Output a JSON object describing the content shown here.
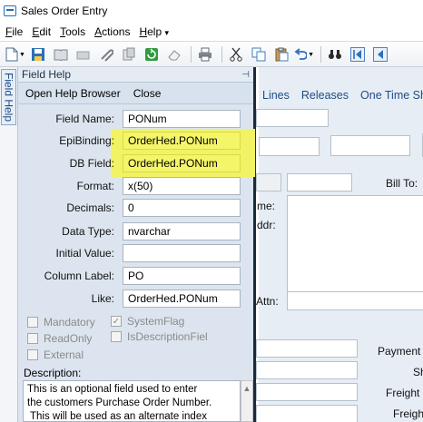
{
  "window": {
    "title": "Sales Order Entry"
  },
  "menubar": [
    {
      "hotkey": "F",
      "rest": "ile"
    },
    {
      "hotkey": "E",
      "rest": "dit"
    },
    {
      "hotkey": "T",
      "rest": "ools"
    },
    {
      "hotkey": "A",
      "rest": "ctions"
    },
    {
      "hotkey": "H",
      "rest": "elp"
    }
  ],
  "menu_overflow": "▾",
  "toolbar": {
    "icons": [
      "new-icon",
      "save-icon",
      "book-icon",
      "erase-icon",
      "attach-icon",
      "copy-doc-icon",
      "refresh-icon",
      "eraser-icon",
      "print-icon",
      "cut-icon",
      "copy-icon",
      "paste-icon",
      "undo-icon",
      "find-icon",
      "first-record-icon",
      "prev-record-icon"
    ]
  },
  "sidetab": {
    "label": "Field Help"
  },
  "help_panel": {
    "title": "Field Help",
    "pin": "⊣",
    "actions": {
      "open": "Open Help Browser",
      "close": "Close"
    },
    "fields": [
      {
        "label": "Field Name:",
        "value": "PONum",
        "highlight": false
      },
      {
        "label": "EpiBinding:",
        "value": "OrderHed.PONum",
        "highlight": true
      },
      {
        "label": "DB Field:",
        "value": "OrderHed.PONum",
        "highlight": true
      },
      {
        "label": "Format:",
        "value": "x(50)",
        "highlight": false
      },
      {
        "label": "Decimals:",
        "value": "0",
        "highlight": false
      },
      {
        "label": "Data Type:",
        "value": "nvarchar",
        "highlight": false
      },
      {
        "label": "Initial Value:",
        "value": "",
        "highlight": false
      },
      {
        "label": "Column Label:",
        "value": "PO",
        "highlight": false
      },
      {
        "label": "Like:",
        "value": "OrderHed.PONum",
        "highlight": false
      }
    ],
    "checkboxes": {
      "mandatory": {
        "label": "Mandatory",
        "checked": false
      },
      "system_flag": {
        "label": "SystemFlag",
        "checked": true
      },
      "read_only": {
        "label": "ReadOnly",
        "checked": false
      },
      "is_description": {
        "label": "IsDescriptionFiel",
        "checked": false
      },
      "external": {
        "label": "External",
        "checked": false
      }
    },
    "description_label": "Description:",
    "description_lines": [
      "This is an optional field used to enter",
      "the customers Purchase Order Number.",
      " This will be used as an alternate index"
    ]
  },
  "main_form": {
    "tabs": [
      "Lines",
      "Releases",
      "One Time Sh"
    ],
    "labels": {
      "bill_to": "Bill To:",
      "name_partial": "me:",
      "addr_partial": "ddr:",
      "attn_partial": "Attn:",
      "payment": "Payment",
      "sh": "Sh",
      "freight1": "Freight",
      "freight2": "Freigh"
    }
  }
}
